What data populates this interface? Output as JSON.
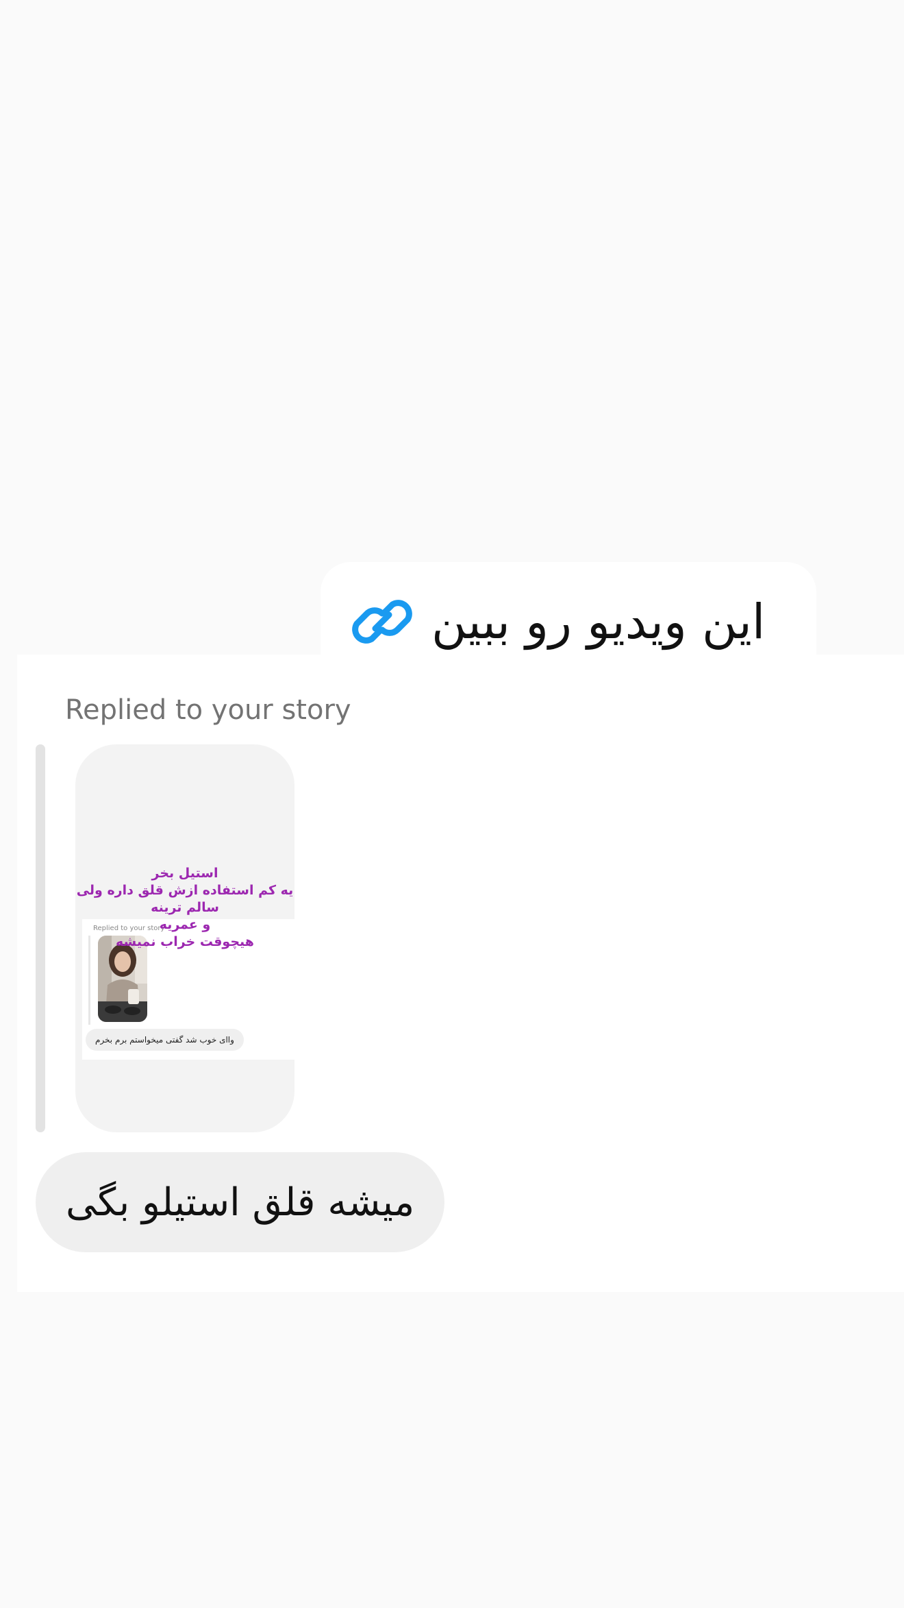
{
  "link_message": {
    "icon": "link-icon",
    "text": "این ویدیو رو ببین"
  },
  "reply": {
    "label": "Replied to your story",
    "story": {
      "overlay_lines": [
        "استیل بخر",
        "یه کم استفاده ازش قلق داره ولی",
        "سالم ترینه",
        "و عمریه",
        "هیچوقت خراب نمیشه"
      ],
      "nested": {
        "replied_label": "Replied to your story",
        "message": "واای خوب شد گفتی میخواستم برم بخرم"
      }
    },
    "message": "میشه قلق استیلو بگی"
  },
  "colors": {
    "background": "#fafafa",
    "link_icon": "#1a9af0",
    "story_text": "#9c27b0",
    "bubble": "#efefef"
  }
}
